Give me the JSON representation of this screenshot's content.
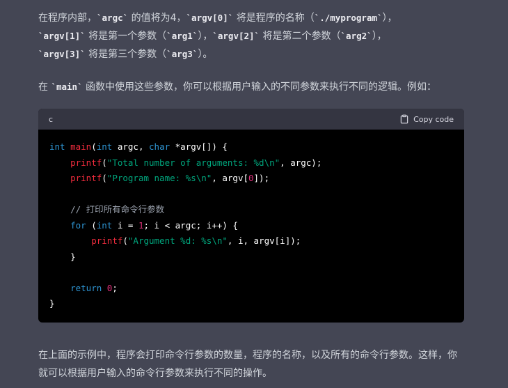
{
  "p1": {
    "t1": "在程序内部，",
    "c1": "`argc`",
    "t2": " 的值将为4，",
    "c2": "`argv[0]`",
    "t3": " 将是程序的名称（",
    "c3": "`./myprogram`",
    "t4": "），",
    "c4": "`argv[1]`",
    "t5": " 将是第一个参数（",
    "c5": "`arg1`",
    "t6": "），",
    "c6": "`argv[2]`",
    "t7": " 将是第二个参数（",
    "c7": "`arg2`",
    "t8": "），",
    "c8": "`argv[3]`",
    "t9": " 将是第三个参数（",
    "c9": "`arg3`",
    "t10": "）。"
  },
  "p2": {
    "t1": "在 ",
    "c1": "`main`",
    "t2": " 函数中使用这些参数，你可以根据用户输入的不同参数来执行不同的逻辑。例如："
  },
  "code": {
    "language": "c",
    "copy_label": "Copy code",
    "l1": {
      "kw1": "int",
      "fn1": "main",
      "p1": "(",
      "kw2": "int",
      "p2": " argc, ",
      "kw3": "char",
      "p3": " *argv[]) {"
    },
    "l2": {
      "indent": "    ",
      "fn": "printf",
      "p1": "(",
      "s": "\"Total number of arguments: %d\\n\"",
      "p2": ", argc);"
    },
    "l3": {
      "indent": "    ",
      "fn": "printf",
      "p1": "(",
      "s": "\"Program name: %s\\n\"",
      "p2": ", argv[",
      "n": "0",
      "p3": "]);"
    },
    "l5": {
      "indent": "    ",
      "cm": "// 打印所有命令行参数"
    },
    "l6": {
      "indent": "    ",
      "kw1": "for",
      "p1": " (",
      "kw2": "int",
      "p2": " i = ",
      "n": "1",
      "p3": "; i < argc; i++) {"
    },
    "l7": {
      "indent": "        ",
      "fn": "printf",
      "p1": "(",
      "s": "\"Argument %d: %s\\n\"",
      "p2": ", i, argv[i]);"
    },
    "l8": {
      "indent": "    ",
      "p": "}"
    },
    "l10": {
      "indent": "    ",
      "kw": "return",
      "p1": " ",
      "n": "0",
      "p2": ";"
    },
    "l11": {
      "p": "}"
    }
  },
  "p3": {
    "text": "在上面的示例中，程序会打印命令行参数的数量，程序的名称，以及所有的命令行参数。这样，你就可以根据用户输入的命令行参数来执行不同的操作。"
  }
}
